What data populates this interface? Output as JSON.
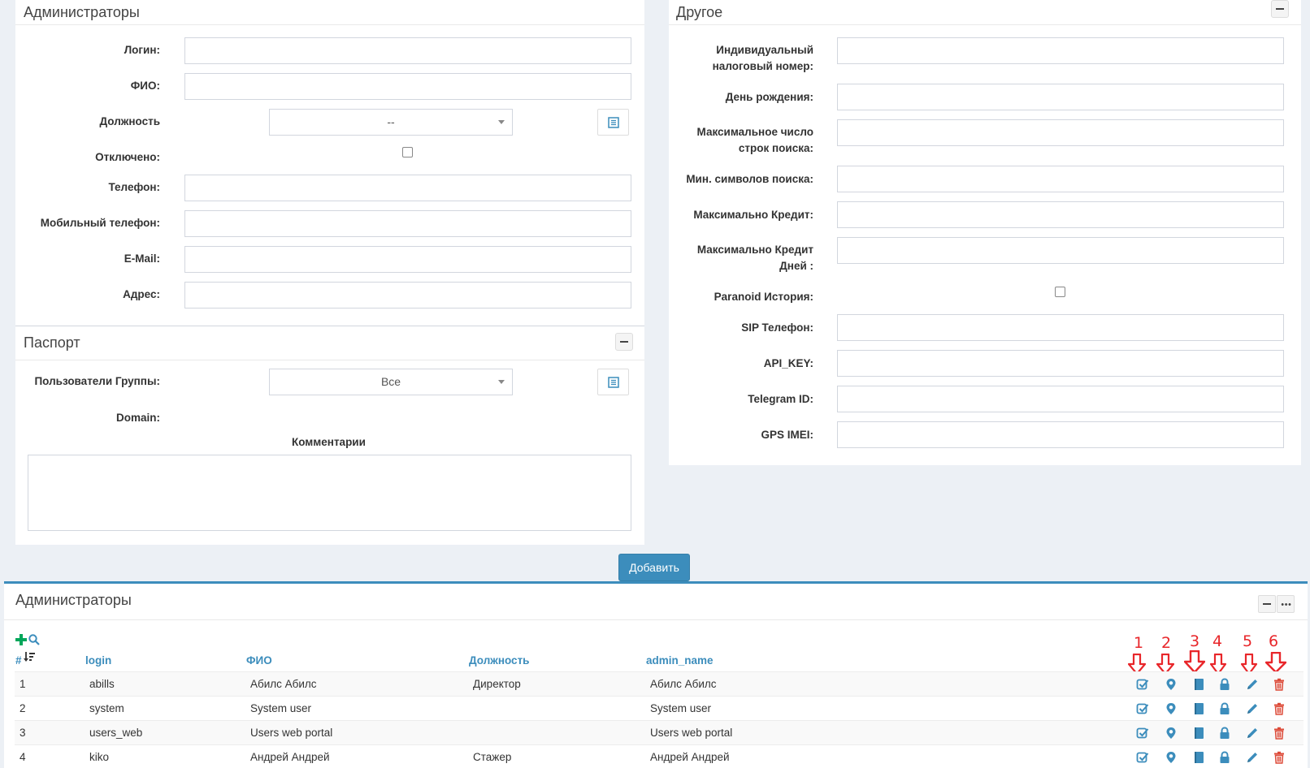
{
  "admin_form": {
    "title": "Администраторы",
    "login_label": "Логин:",
    "fio_label": "ФИО:",
    "position_label": "Должность",
    "position_value": "--",
    "disabled_label": "Отключено:",
    "phone_label": "Телефон:",
    "mobile_label": "Мобильный телефон:",
    "email_label": "E-Mail:",
    "address_label": "Адрес:"
  },
  "passport": {
    "title": "Паспорт",
    "groups_label": "Пользователи Группы:",
    "groups_value": "Все",
    "domain_label": "Domain:",
    "comments_label": "Комментарии"
  },
  "other": {
    "title": "Другое",
    "inn_label_1": "Индивидуальный",
    "inn_label_2": "налоговый номер:",
    "birthday_label": "День рождения:",
    "max_rows_label_1": "Максимальное число",
    "max_rows_label_2": "строк поиска:",
    "min_chars_label": "Мин. символов поиска:",
    "max_credit_label": "Максимально Кредит:",
    "max_credit_days_label_1": "Максимально Кредит",
    "max_credit_days_label_2": "Дней :",
    "paranoid_label": "Paranoid История:",
    "sip_label": "SIP Телефон:",
    "api_key_label": "API_KEY:",
    "telegram_label": "Telegram ID:",
    "gps_label": "GPS IMEI:"
  },
  "add_button": "Добавить",
  "table": {
    "title": "Администраторы",
    "columns": [
      "#",
      "login",
      "ФИО",
      "Должность",
      "admin_name"
    ],
    "rows": [
      {
        "id": "1",
        "login": "abills",
        "fio": "Абилс Абилс",
        "position": "Директор",
        "admin_name": "Абилс Абилс"
      },
      {
        "id": "2",
        "login": "system",
        "fio": "System user",
        "position": "",
        "admin_name": "System user"
      },
      {
        "id": "3",
        "login": "users_web",
        "fio": "Users web portal",
        "position": "",
        "admin_name": "Users web portal"
      },
      {
        "id": "4",
        "login": "kiko",
        "fio": "Андрей Андрей",
        "position": "Стажер",
        "admin_name": "Андрей Андрей"
      }
    ],
    "action_icons": [
      "check-square-icon",
      "map-marker-icon",
      "book-icon",
      "lock-icon",
      "pencil-icon",
      "trash-icon"
    ],
    "annotations": [
      "1",
      "2",
      "3",
      "4",
      "5",
      "6"
    ]
  },
  "colors": {
    "accent": "#3c8dbc",
    "danger": "#dd4b39",
    "add_icon": "#00a65a",
    "annotation": "#e8262a"
  }
}
